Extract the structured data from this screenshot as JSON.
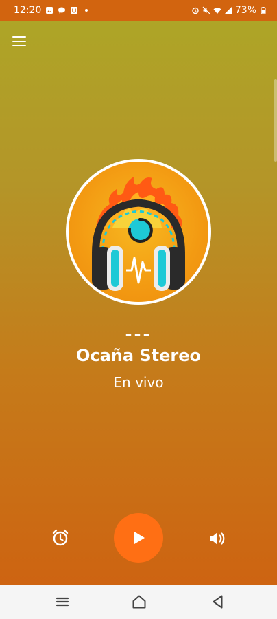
{
  "status_bar": {
    "time": "12:20",
    "battery": "73%",
    "background_color": "#d2640f"
  },
  "header": {
    "menu_icon": "hamburger-menu-icon"
  },
  "now_playing": {
    "artwork_icon": "headphones-flame-logo",
    "track": "---",
    "station_name": "Ocaña Stereo",
    "status": "En vivo"
  },
  "controls": {
    "alarm_icon": "alarm-clock-icon",
    "play_icon": "play-icon",
    "volume_icon": "volume-icon",
    "play_button_color": "#ff6f14"
  },
  "nav_bar": {
    "recents_icon": "recents-icon",
    "home_icon": "home-icon",
    "back_icon": "back-icon"
  },
  "theme": {
    "gradient_top": "#ada727",
    "gradient_bottom": "#cf6010"
  }
}
